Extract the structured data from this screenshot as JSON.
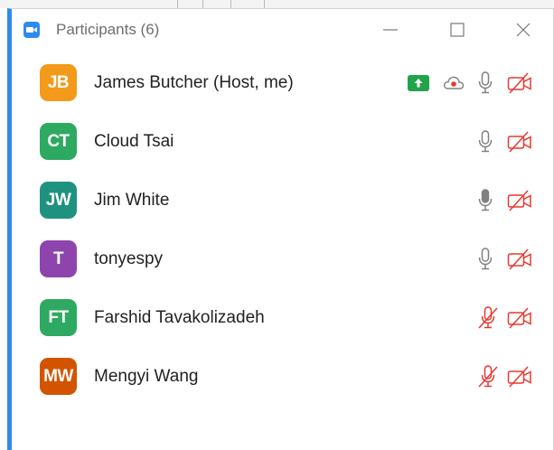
{
  "window": {
    "title": "Participants (6)"
  },
  "colors": {
    "accent": "#2d8ceb",
    "muted_red": "#e8382f",
    "share_green": "#22a34a"
  },
  "participants": [
    {
      "initials": "JB",
      "name": "James Butcher (Host, me)",
      "avatar_color": "#f39a1a",
      "sharing": true,
      "recording": true,
      "muted": false,
      "video_off": true
    },
    {
      "initials": "CT",
      "name": "Cloud Tsai",
      "avatar_color": "#2ea962",
      "sharing": false,
      "recording": false,
      "muted": false,
      "video_off": true
    },
    {
      "initials": "JW",
      "name": "Jim White",
      "avatar_color": "#1e927f",
      "sharing": false,
      "recording": false,
      "muted": false,
      "video_off": true
    },
    {
      "initials": "T",
      "name": "tonyespy",
      "avatar_color": "#8e44ad",
      "sharing": false,
      "recording": false,
      "muted": false,
      "video_off": true
    },
    {
      "initials": "FT",
      "name": "Farshid Tavakolizadeh",
      "avatar_color": "#2ea962",
      "sharing": false,
      "recording": false,
      "muted": true,
      "video_off": true
    },
    {
      "initials": "MW",
      "name": "Mengyi Wang",
      "avatar_color": "#d35400",
      "sharing": false,
      "recording": false,
      "muted": true,
      "video_off": true
    }
  ]
}
